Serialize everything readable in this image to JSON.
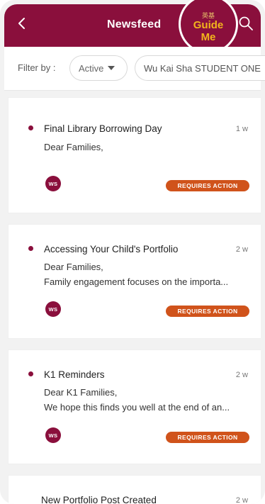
{
  "header": {
    "title": "Newsfeed",
    "guide_small": "英基",
    "guide_label": "Guide\nMe"
  },
  "filter": {
    "label": "Filter by :",
    "status": "Active",
    "student": "Wu Kai Sha STUDENT ONE"
  },
  "feed": [
    {
      "title": "Final Library Borrowing Day",
      "time": "1 w",
      "lines": [
        "Dear Families,"
      ],
      "avatar": "WS",
      "badge": "REQUIRES ACTION"
    },
    {
      "title": "Accessing Your Child's Portfolio",
      "time": "2 w",
      "lines": [
        "Dear Families,",
        "Family engagement focuses on the importa..."
      ],
      "avatar": "WS",
      "badge": "REQUIRES ACTION"
    },
    {
      "title": "K1 Reminders",
      "time": "2 w",
      "lines": [
        "Dear K1 Families,",
        "We hope this finds you well at the end of an..."
      ],
      "avatar": "WS",
      "badge": "REQUIRES ACTION"
    },
    {
      "title": "New Portfolio Post Created",
      "time": "2 w"
    }
  ],
  "colors": {
    "brand": "#8a0f3c",
    "accent": "#f2b51c",
    "badge": "#d0531b"
  },
  "icons": {
    "back": "chevron-left-icon",
    "search": "search-icon",
    "dropdown": "caret-down-icon"
  }
}
